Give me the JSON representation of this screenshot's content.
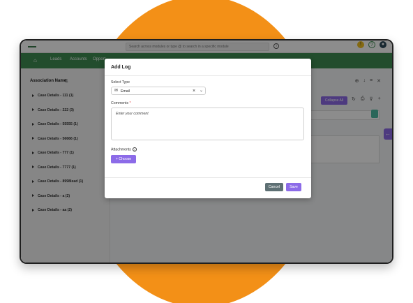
{
  "colors": {
    "accent": "#8c6be8",
    "nav_green": "#3e8d52",
    "background_circle": "#f39017",
    "cancel": "#5e7074"
  },
  "topbar": {
    "search_placeholder": "Search across modules or type @ to search in a specific module"
  },
  "nav": {
    "items": [
      "Leads",
      "Accounts",
      "Opport"
    ]
  },
  "left_panel": {
    "header": "Association Name",
    "cases": [
      "Case Details - 111 (1)",
      "Case Details - 222 (3)",
      "Case Details - 55555 (1)",
      "Case Details - 56666 (1)",
      "Case Details - 777 (1)",
      "Case Details - 7777 (1)",
      "Case Details - 8998lead (1)",
      "Case Details - a (2)",
      "Case Details - aa (2)"
    ]
  },
  "right_panel": {
    "collapse_label": "Collapse All"
  },
  "modal": {
    "title": "Add Log",
    "select_type_label": "Select Type",
    "select_type_value": "Email",
    "comments_label": "Comments",
    "comments_required": "*",
    "comments_placeholder": "Enter your comment",
    "attachments_label": "Attachments",
    "choose_label": "Choose",
    "cancel_label": "Cancel",
    "save_label": "Save"
  }
}
